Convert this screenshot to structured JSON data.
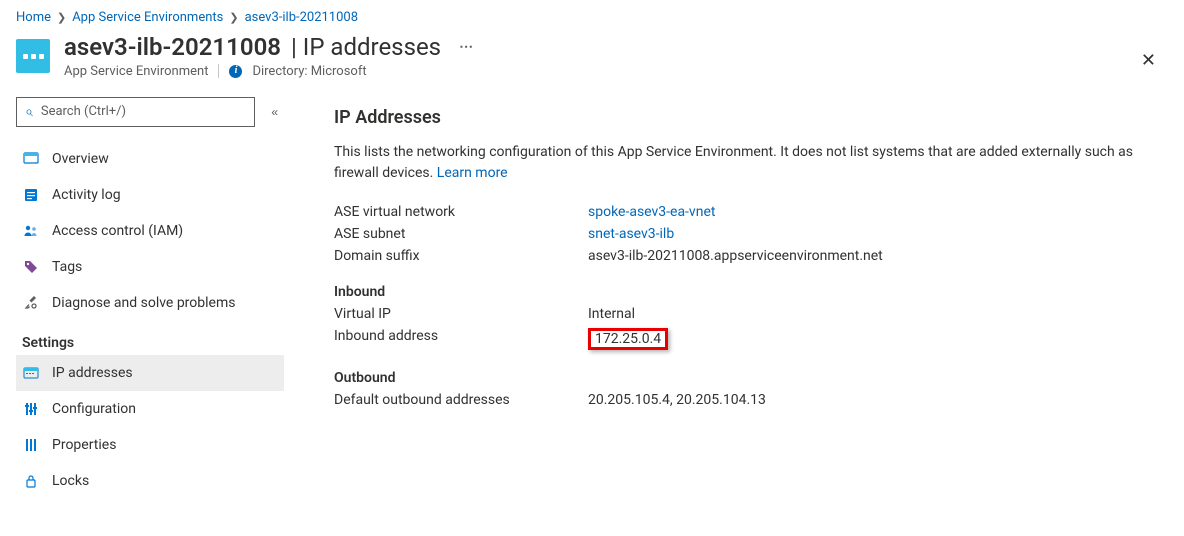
{
  "breadcrumb": {
    "home": "Home",
    "parent": "App Service Environments",
    "current": "asev3-ilb-20211008"
  },
  "header": {
    "resource_name": "asev3-ilb-20211008",
    "page_subtitle": "IP addresses",
    "resource_type": "App Service Environment",
    "directory_label": "Directory: Microsoft"
  },
  "sidebar": {
    "search_placeholder": "Search (Ctrl+/)",
    "items": {
      "overview": "Overview",
      "activity_log": "Activity log",
      "access_control": "Access control (IAM)",
      "tags": "Tags",
      "diagnose": "Diagnose and solve problems"
    },
    "settings_label": "Settings",
    "settings_items": {
      "ip_addresses": "IP addresses",
      "configuration": "Configuration",
      "properties": "Properties",
      "locks": "Locks"
    }
  },
  "main": {
    "heading": "IP Addresses",
    "description_prefix": "This lists the networking configuration of this App Service Environment. It does not list systems that are added externally such as firewall devices. ",
    "learn_more": "Learn more",
    "labels": {
      "ase_vnet": "ASE virtual network",
      "ase_subnet": "ASE subnet",
      "domain_suffix": "Domain suffix",
      "inbound_section": "Inbound",
      "virtual_ip": "Virtual IP",
      "inbound_address": "Inbound address",
      "outbound_section": "Outbound",
      "default_outbound": "Default outbound addresses"
    },
    "values": {
      "ase_vnet": "spoke-asev3-ea-vnet",
      "ase_subnet": "snet-asev3-ilb",
      "domain_suffix": "asev3-ilb-20211008.appserviceenvironment.net",
      "virtual_ip": "Internal",
      "inbound_address": "172.25.0.4",
      "default_outbound": "20.205.105.4, 20.205.104.13"
    }
  }
}
